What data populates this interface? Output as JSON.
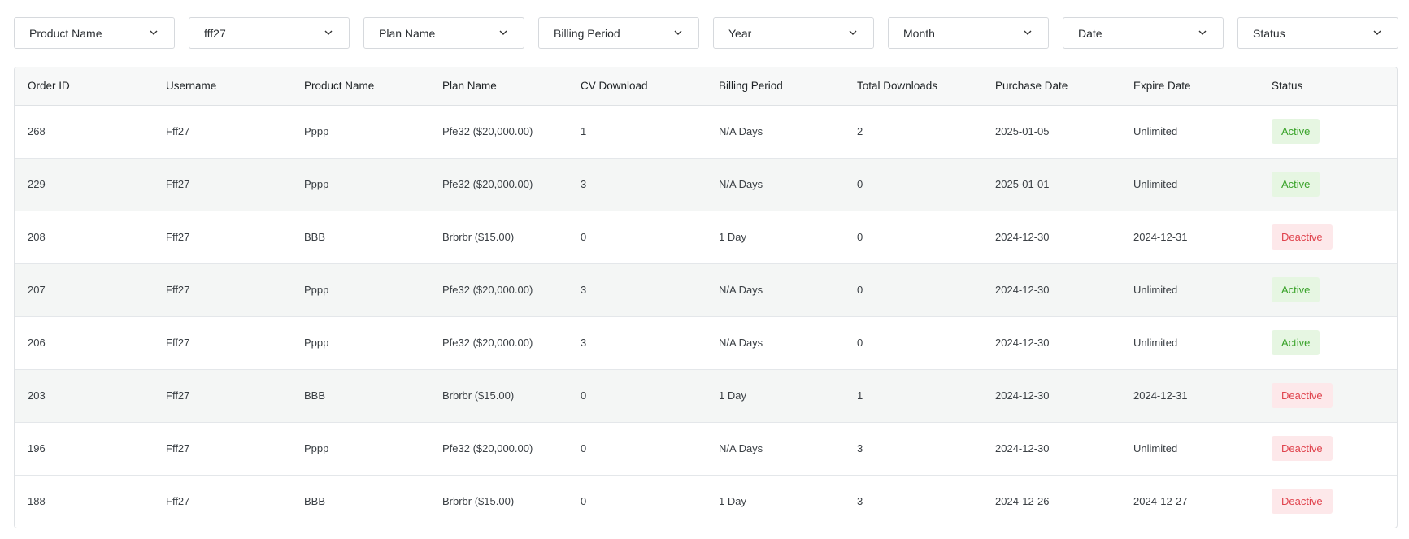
{
  "filters": [
    {
      "label": "Product Name",
      "icon": "chevron-down-icon"
    },
    {
      "label": "fff27",
      "icon": "chevron-down-icon"
    },
    {
      "label": "Plan Name",
      "icon": "chevron-down-icon"
    },
    {
      "label": "Billing Period",
      "icon": "chevron-down-icon"
    },
    {
      "label": "Year",
      "icon": "chevron-down-icon"
    },
    {
      "label": "Month",
      "icon": "chevron-down-icon"
    },
    {
      "label": "Date",
      "icon": "chevron-down-icon"
    },
    {
      "label": "Status",
      "icon": "chevron-down-icon"
    }
  ],
  "table": {
    "columns": [
      "Order ID",
      "Username",
      "Product Name",
      "Plan Name",
      "CV Download",
      "Billing Period",
      "Total Downloads",
      "Purchase Date",
      "Expire Date",
      "Status"
    ],
    "rows": [
      {
        "order_id": "268",
        "username": "Fff27",
        "product": "Pppp",
        "plan": "Pfe32 ($20,000.00)",
        "cv_download": "1",
        "billing": "N/A Days",
        "total_downloads": "2",
        "purchase_date": "2025-01-05",
        "expire_date": "Unlimited",
        "status": "Active"
      },
      {
        "order_id": "229",
        "username": "Fff27",
        "product": "Pppp",
        "plan": "Pfe32 ($20,000.00)",
        "cv_download": "3",
        "billing": "N/A Days",
        "total_downloads": "0",
        "purchase_date": "2025-01-01",
        "expire_date": "Unlimited",
        "status": "Active"
      },
      {
        "order_id": "208",
        "username": "Fff27",
        "product": "BBB",
        "plan": "Brbrbr ($15.00)",
        "cv_download": "0",
        "billing": "1 Day",
        "total_downloads": "0",
        "purchase_date": "2024-12-30",
        "expire_date": "2024-12-31",
        "status": "Deactive"
      },
      {
        "order_id": "207",
        "username": "Fff27",
        "product": "Pppp",
        "plan": "Pfe32 ($20,000.00)",
        "cv_download": "3",
        "billing": "N/A Days",
        "total_downloads": "0",
        "purchase_date": "2024-12-30",
        "expire_date": "Unlimited",
        "status": "Active"
      },
      {
        "order_id": "206",
        "username": "Fff27",
        "product": "Pppp",
        "plan": "Pfe32 ($20,000.00)",
        "cv_download": "3",
        "billing": "N/A Days",
        "total_downloads": "0",
        "purchase_date": "2024-12-30",
        "expire_date": "Unlimited",
        "status": "Active"
      },
      {
        "order_id": "203",
        "username": "Fff27",
        "product": "BBB",
        "plan": "Brbrbr ($15.00)",
        "cv_download": "0",
        "billing": "1 Day",
        "total_downloads": "1",
        "purchase_date": "2024-12-30",
        "expire_date": "2024-12-31",
        "status": "Deactive"
      },
      {
        "order_id": "196",
        "username": "Fff27",
        "product": "Pppp",
        "plan": "Pfe32 ($20,000.00)",
        "cv_download": "0",
        "billing": "N/A Days",
        "total_downloads": "3",
        "purchase_date": "2024-12-30",
        "expire_date": "Unlimited",
        "status": "Deactive"
      },
      {
        "order_id": "188",
        "username": "Fff27",
        "product": "BBB",
        "plan": "Brbrbr ($15.00)",
        "cv_download": "0",
        "billing": "1 Day",
        "total_downloads": "3",
        "purchase_date": "2024-12-26",
        "expire_date": "2024-12-27",
        "status": "Deactive"
      }
    ]
  },
  "colors": {
    "active_bg": "#e6f6e2",
    "active_text": "#3aa32a",
    "deactive_bg": "#fde8ea",
    "deactive_text": "#e0444e",
    "alt_row_bg": "#f4f6f5"
  }
}
